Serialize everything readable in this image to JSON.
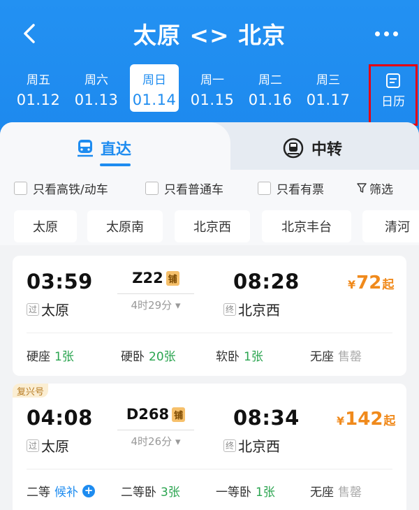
{
  "header": {
    "title": "太原 <> 北京",
    "back_icon": "chevron-left-icon",
    "more_icon": "more-dots-icon"
  },
  "dates": [
    {
      "weekday": "周五",
      "date": "01.12",
      "selected": false
    },
    {
      "weekday": "周六",
      "date": "01.13",
      "selected": false
    },
    {
      "weekday": "周日",
      "date": "01.14",
      "selected": true
    },
    {
      "weekday": "周一",
      "date": "01.15",
      "selected": false
    },
    {
      "weekday": "周二",
      "date": "01.16",
      "selected": false
    },
    {
      "weekday": "周三",
      "date": "01.17",
      "selected": false
    }
  ],
  "calendar": {
    "label": "日历",
    "icon": "calendar-icon"
  },
  "tabs": {
    "direct": {
      "label": "直达",
      "icon": "train-icon"
    },
    "transfer": {
      "label": "中转",
      "icon": "transfer-train-icon"
    }
  },
  "filters": {
    "high_speed": "只看高铁/动车",
    "normal": "只看普通车",
    "available": "只看有票",
    "filter_label": "筛选"
  },
  "stations": [
    "太原",
    "太原南",
    "北京西",
    "北京丰台",
    "清河"
  ],
  "trains": [
    {
      "dep_time": "03:59",
      "train_no": "Z22",
      "badge": "铺",
      "duration": "4时29分",
      "arr_time": "08:28",
      "dep_tag": "过",
      "dep_station": "太原",
      "arr_tag": "终",
      "arr_station": "北京西",
      "price_symbol": "¥",
      "price": "72",
      "price_suffix": "起",
      "seats": [
        {
          "name": "硬座",
          "count": "1张",
          "status": "green"
        },
        {
          "name": "硬卧",
          "count": "20张",
          "status": "green"
        },
        {
          "name": "软卧",
          "count": "1张",
          "status": "green"
        },
        {
          "name": "无座",
          "count": "售罄",
          "status": "gray"
        }
      ]
    },
    {
      "tag": "复兴号",
      "dep_time": "04:08",
      "train_no": "D268",
      "badge": "铺",
      "duration": "4时26分",
      "arr_time": "08:34",
      "dep_tag": "过",
      "dep_station": "太原",
      "arr_tag": "终",
      "arr_station": "北京西",
      "price_symbol": "¥",
      "price": "142",
      "price_suffix": "起",
      "seats": [
        {
          "name": "二等",
          "count": "候补",
          "status": "blue"
        },
        {
          "name": "二等卧",
          "count": "3张",
          "status": "green"
        },
        {
          "name": "一等卧",
          "count": "1张",
          "status": "green"
        },
        {
          "name": "无座",
          "count": "售罄",
          "status": "gray"
        }
      ]
    }
  ],
  "colors": {
    "primary": "#1e8cf0",
    "price": "#f08a1c",
    "available": "#2aa44f",
    "soldout": "#aaaaaa",
    "highlight_border": "#e60012"
  }
}
